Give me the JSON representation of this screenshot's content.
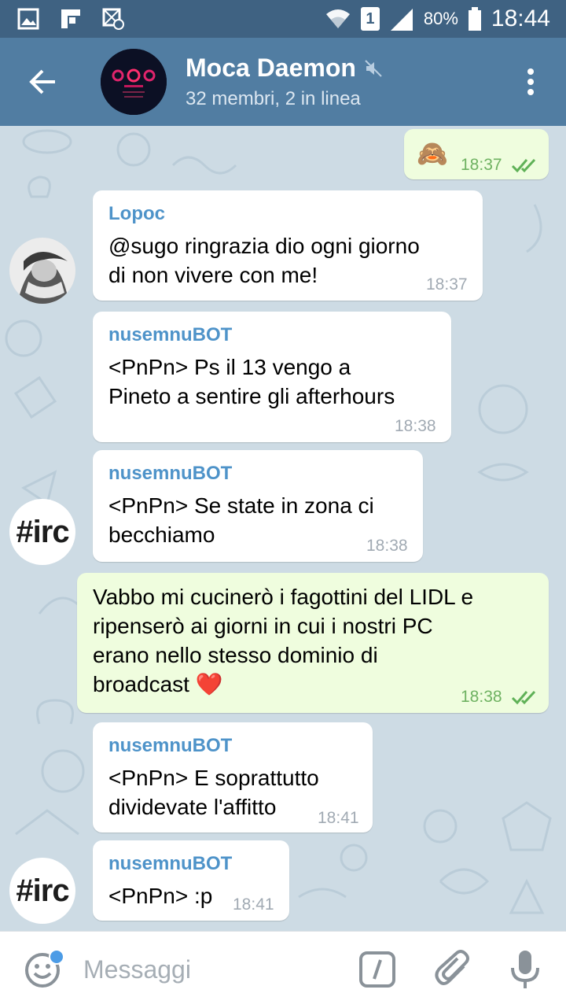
{
  "status_bar": {
    "battery": "80%",
    "time": "18:44",
    "sim": "1"
  },
  "header": {
    "title": "Moca Daemon",
    "subtitle": "32 membri, 2 in linea"
  },
  "messages": [
    {
      "direction": "out",
      "text": "🙈",
      "time": "18:37",
      "read": true
    },
    {
      "direction": "in",
      "sender": "Lopoc",
      "text": "@sugo ringrazia dio ogni giorno\ndi non vivere con me!",
      "time": "18:37"
    },
    {
      "direction": "in",
      "sender": "nusemnuBOT",
      "text": "<PnPn> Ps il 13 vengo a\nPineto a sentire gli afterhours",
      "time": "18:38"
    },
    {
      "direction": "in",
      "sender": "nusemnuBOT",
      "text": "<PnPn> Se state in zona ci\nbecchiamo",
      "time": "18:38"
    },
    {
      "direction": "out",
      "text": "Vabbo mi cucinerò i fagottini del LIDL e\nripenserò ai giorni in cui i nostri PC\nerano nello stesso dominio di\nbroadcast ❤️",
      "time": "18:38",
      "read": true
    },
    {
      "direction": "in",
      "sender": "nusemnuBOT",
      "text": "<PnPn> E soprattutto\ndividevate l'affitto",
      "time": "18:41"
    },
    {
      "direction": "in",
      "sender": "nusemnuBOT",
      "text": "<PnPn> :p",
      "time": "18:41"
    }
  ],
  "avatars": {
    "irc_label": "#irc"
  },
  "input": {
    "placeholder": "Messaggi"
  },
  "colors": {
    "header": "#517da2",
    "status_bar": "#3f6282",
    "out_bubble": "#effdde",
    "sender": "#4e93c9"
  }
}
